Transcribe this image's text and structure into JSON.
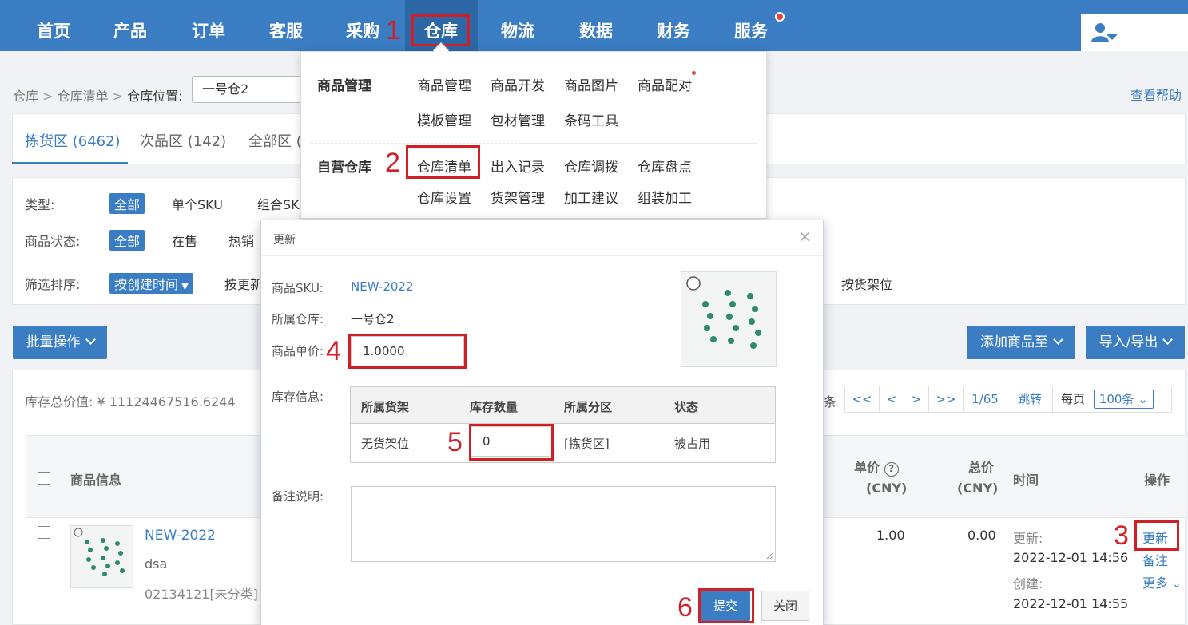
{
  "nav": {
    "items": [
      "首页",
      "产品",
      "订单",
      "客服",
      "采购",
      "仓库",
      "物流",
      "数据",
      "财务",
      "服务"
    ],
    "active": "仓库"
  },
  "breadcrumb": {
    "part1": "仓库",
    "part2": "仓库清单",
    "location_label": "仓库位置:",
    "location_value": "一号仓2"
  },
  "help_link": "查看帮助",
  "tabs": [
    "拣货区 (6462)",
    "次品区 (142)",
    "全部区 ("
  ],
  "filters": {
    "type_label": "类型:",
    "type_options": [
      "全部",
      "单个SKU",
      "组合SK"
    ],
    "status_label": "商品状态:",
    "status_options": [
      "全部",
      "在售",
      "热销"
    ],
    "sort_label": "筛选排序:",
    "sort_options": [
      "按创建时间",
      "按更新",
      "按货架位"
    ]
  },
  "toolbar": {
    "batch": "批量操作",
    "add_to": "添加商品至",
    "import_export": "导入/导出"
  },
  "summary": {
    "label": "库存总价值: ¥ 11124467516.6244"
  },
  "pager": {
    "unit_suffix": "条",
    "first": "<<",
    "prev": "<",
    "next": ">",
    "last": ">>",
    "page": "1/65",
    "jump": "跳转",
    "per_page_label": "每页",
    "per_page_value": "100条"
  },
  "table": {
    "headers": {
      "info": "商品信息",
      "price": "单价",
      "price_unit": "(CNY)",
      "total": "总价",
      "total_unit": "(CNY)",
      "time": "时间",
      "ops": "操作"
    },
    "row": {
      "sku": "NEW-2022",
      "name": "dsa",
      "code": "02134121[未分类]",
      "price": "1.00",
      "total": "0.00",
      "updated_label": "更新:",
      "updated": "2022-12-01 14:56",
      "created_label": "创建:",
      "created": "2022-12-01 14:55",
      "op_update": "更新",
      "op_note": "备注",
      "op_more": "更多"
    }
  },
  "menu": {
    "section1": "商品管理",
    "section1_items": [
      "商品管理",
      "商品开发",
      "商品图片",
      "商品配对",
      "模板管理",
      "包材管理",
      "条码工具"
    ],
    "section2": "自营仓库",
    "section2_items": [
      "仓库清单",
      "出入记录",
      "仓库调拨",
      "仓库盘点",
      "仓库设置",
      "货架管理",
      "加工建议",
      "组装加工"
    ]
  },
  "modal": {
    "title": "更新",
    "close": "×",
    "sku_label": "商品SKU:",
    "sku_value": "NEW-2022",
    "warehouse_label": "所属仓库:",
    "warehouse_value": "一号仓2",
    "price_label": "商品单价:",
    "price_value": "1.0000",
    "stock_label": "库存信息:",
    "stock_headers": [
      "所属货架",
      "库存数量",
      "所属分区",
      "状态"
    ],
    "stock_row": {
      "shelf": "无货架位",
      "qty": "0",
      "zone": "[拣货区]",
      "status": "被占用"
    },
    "note_label": "备注说明:",
    "submit": "提交",
    "cancel": "关闭"
  },
  "annotations": [
    "1",
    "2",
    "3",
    "4",
    "5",
    "6"
  ],
  "colors": {
    "nav_bg": "#3a7dc3",
    "accent": "#3a7dc3",
    "annotation": "#d11f26",
    "submit_bg": "#3a7dc3"
  }
}
